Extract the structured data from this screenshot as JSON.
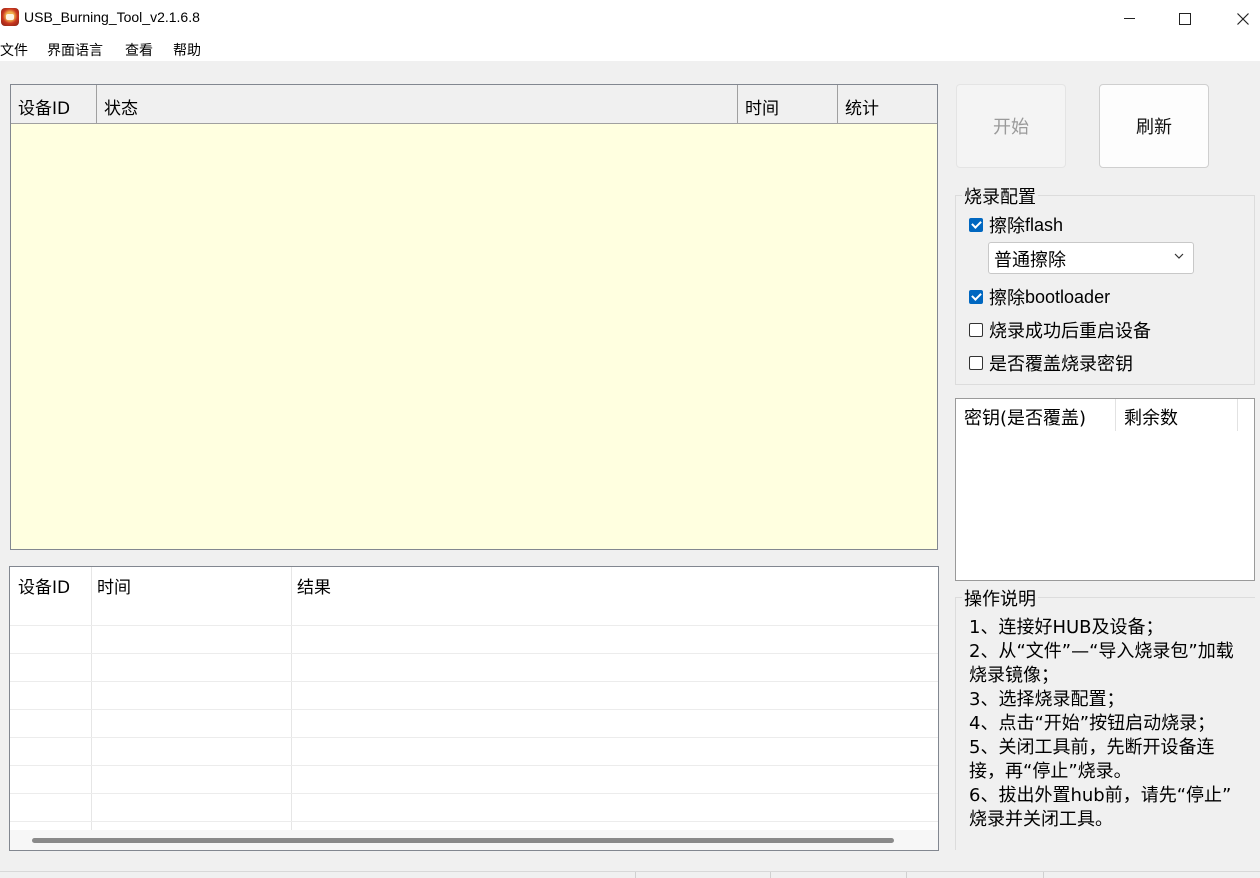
{
  "window": {
    "title": "USB_Burning_Tool_v2.1.6.8"
  },
  "menu": {
    "file": "文件",
    "language": "界面语言",
    "view": "查看",
    "help": "帮助"
  },
  "device_table": {
    "columns": [
      "设备ID",
      "状态",
      "时间",
      "统计"
    ],
    "background_color": "#ffffe0"
  },
  "result_table": {
    "columns": [
      "设备ID",
      "时间",
      "结果"
    ]
  },
  "buttons": {
    "start": "开始",
    "start_enabled": false,
    "refresh": "刷新"
  },
  "burn_config": {
    "legend": "烧录配置",
    "erase_flash": {
      "label_prefix": "擦除",
      "label_suffix": "flash",
      "checked": true
    },
    "erase_mode": "普通擦除",
    "erase_bootloader": {
      "label_prefix": "擦除",
      "label_suffix": "bootloader",
      "checked": true
    },
    "reboot_after": {
      "label": "烧录成功后重启设备",
      "checked": false
    },
    "overwrite_key": {
      "label": "是否覆盖烧录密钥",
      "checked": false
    }
  },
  "key_table": {
    "columns": [
      "密钥(是否覆盖)",
      "剩余数"
    ]
  },
  "instructions": {
    "legend": "操作说明",
    "lines": [
      "1、连接好HUB及设备；",
      "2、从“文件”—“导入烧录包”加载",
      "烧录镜像；",
      "3、选择烧录配置；",
      "4、点击“开始”按钮启动烧录；",
      "5、关闭工具前，先断开设备连",
      "接，再“停止”烧录。",
      "6、拔出外置hub前，请先“停止”",
      "烧录并关闭工具。"
    ]
  },
  "colors": {
    "checkbox_accent": "#0067c0",
    "window_bg": "#f0f0f0"
  }
}
